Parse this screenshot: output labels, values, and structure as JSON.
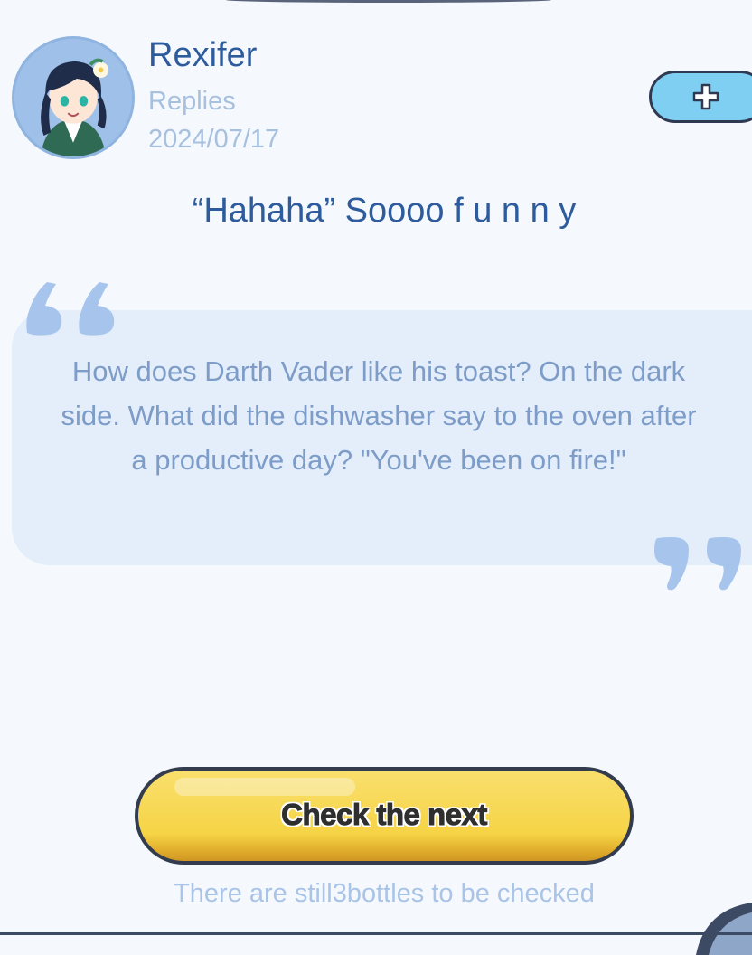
{
  "post": {
    "username": "Rexifer",
    "reply_label": "Replies",
    "date": "2024/07/17",
    "headline": "“Hahaha” Soooo f u n n y"
  },
  "add_button": {
    "icon": "plus-icon"
  },
  "quote": {
    "text": "How does Darth Vader like his toast? On the dark side. What did the dishwasher say to the oven after a productive day? \"You've been on fire!\"",
    "open_icon": "quote-open-icon",
    "close_icon": "quote-close-icon"
  },
  "actions": {
    "next_label": "Check the next",
    "remaining_text": "There are still3bottles to be checked"
  },
  "colors": {
    "background": "#f5f9fe",
    "name": "#2d5b9c",
    "muted": "#a7c0de",
    "quote_box": "#e4eefa",
    "quote_text": "#7d9cc8",
    "add_button": "#7fcff3",
    "next_button": "#f6d446"
  }
}
